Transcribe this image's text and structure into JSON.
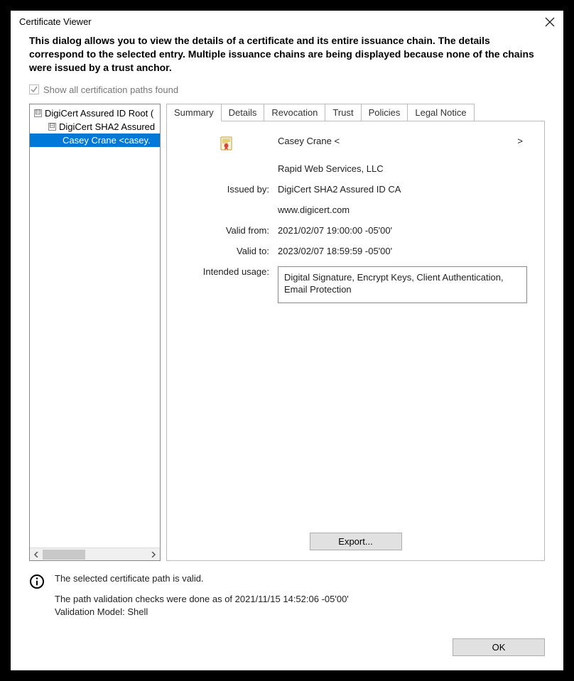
{
  "window": {
    "title": "Certificate Viewer"
  },
  "description": "This dialog allows you to view the details of a certificate and its entire issuance chain. The details correspond to the selected entry. Multiple issuance chains are being displayed because none of the chains were issued by a trust anchor.",
  "checkbox": {
    "label": "Show all certification paths found",
    "checked": true,
    "enabled": false
  },
  "tree": {
    "items": [
      {
        "label": "DigiCert Assured ID Root (",
        "level": 1,
        "expandable": true,
        "selected": false
      },
      {
        "label": "DigiCert SHA2 Assured",
        "level": 2,
        "expandable": true,
        "selected": false
      },
      {
        "label": "Casey Crane <casey.",
        "level": 3,
        "expandable": false,
        "selected": true
      }
    ]
  },
  "tabs": {
    "items": [
      "Summary",
      "Details",
      "Revocation",
      "Trust",
      "Policies",
      "Legal Notice"
    ],
    "active": 0
  },
  "summary": {
    "subject_name": "Casey Crane <",
    "subject_name_tail": ">",
    "org": "Rapid Web Services, LLC",
    "issued_by_label": "Issued by:",
    "issued_by": "DigiCert SHA2 Assured ID CA",
    "issuer_url": "www.digicert.com",
    "valid_from_label": "Valid from:",
    "valid_from": "2021/02/07 19:00:00 -05'00'",
    "valid_to_label": "Valid to:",
    "valid_to": "2023/02/07 18:59:59 -05'00'",
    "usage_label": "Intended usage:",
    "usage": "Digital Signature, Encrypt Keys, Client Authentication, Email Protection"
  },
  "export_label": "Export...",
  "footer": {
    "line1": "The selected certificate path is valid.",
    "line2": "The path validation checks were done as of 2021/11/15 14:52:06 -05'00'",
    "line3": "Validation Model: Shell"
  },
  "ok_label": "OK"
}
